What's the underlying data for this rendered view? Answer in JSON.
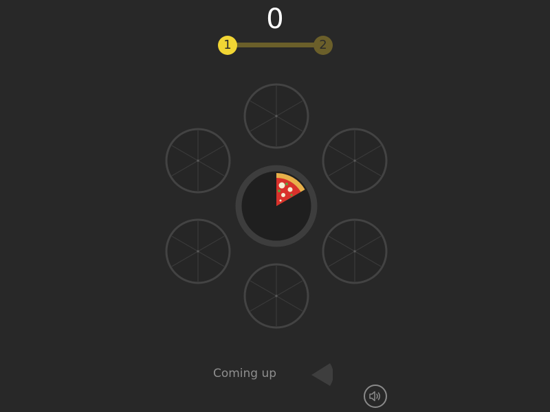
{
  "score": "0",
  "level": {
    "current": "1",
    "next": "2"
  },
  "board": {
    "plates": 6,
    "slices_per_plate": 6,
    "center_plate_filled_slices": 1
  },
  "coming_up": {
    "label": "Coming up"
  },
  "colors": {
    "background": "#282828",
    "level_active": "#f1d534",
    "level_inactive": "#6b5f2a",
    "plate_ring": "#4a4a4a",
    "plate_face": "#262626"
  },
  "icons": {
    "sound": "speaker-icon"
  }
}
